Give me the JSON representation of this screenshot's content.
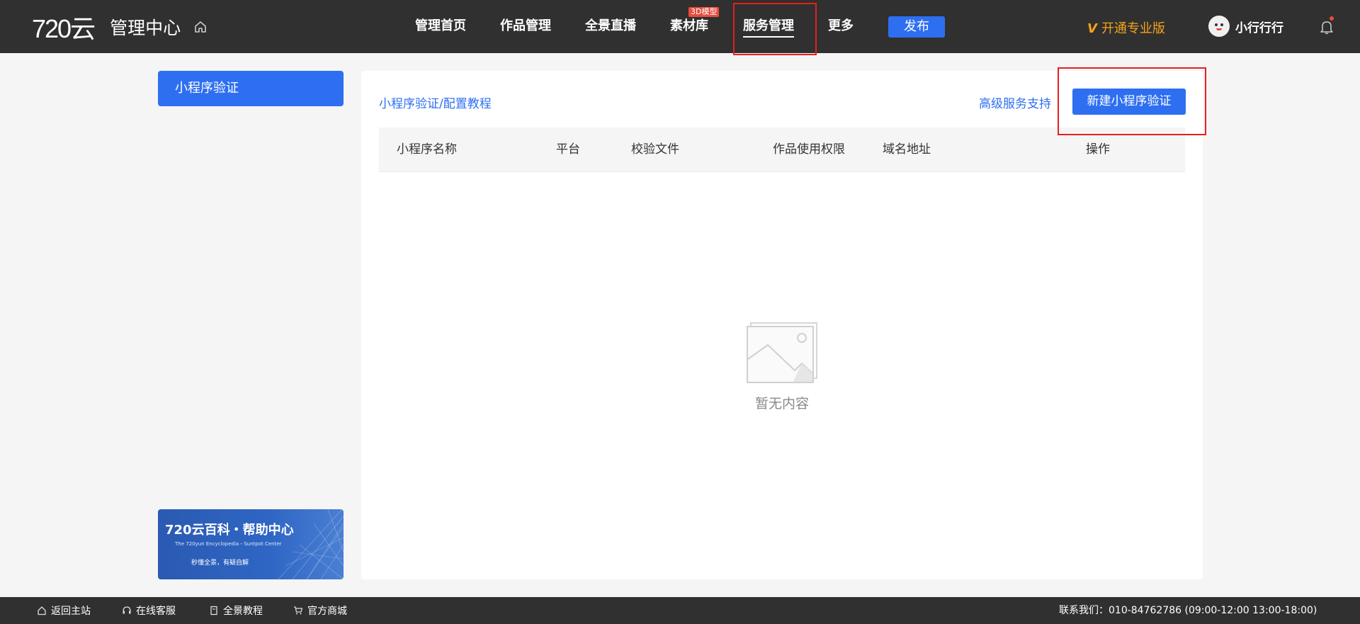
{
  "header": {
    "brand": "720云",
    "title": "管理中心",
    "nav": [
      {
        "label": "管理首页"
      },
      {
        "label": "作品管理"
      },
      {
        "label": "全景直播"
      },
      {
        "label": "素材库",
        "badge": "3D模型"
      },
      {
        "label": "服务管理",
        "active": true
      },
      {
        "label": "更多"
      }
    ],
    "publish_label": "发布",
    "pro_v": "V",
    "pro_label": "开通专业版",
    "username": "小行行行"
  },
  "sidebar": {
    "items": [
      {
        "label": "小程序验证"
      }
    ],
    "banner": {
      "title": "720云百科・帮助中心",
      "subtitle": "The 720yun Encyclopedia・Suntpot Center",
      "tagline": "秒懂全景，有疑自解"
    }
  },
  "main": {
    "breadcrumb": "小程序验证/配置教程",
    "support_label": "高级服务支持",
    "new_button": "新建小程序验证",
    "table": {
      "columns": [
        "小程序名称",
        "平台",
        "校验文件",
        "作品使用权限",
        "域名地址",
        "操作"
      ],
      "rows": []
    },
    "empty_text": "暂无内容"
  },
  "footer": {
    "links": [
      {
        "label": "返回主站",
        "icon": "home-icon"
      },
      {
        "label": "在线客服",
        "icon": "headset-icon"
      },
      {
        "label": "全景教程",
        "icon": "book-icon"
      },
      {
        "label": "官方商城",
        "icon": "cart-icon"
      }
    ],
    "contact": "联系我们：010-84762786 (09:00-12:00 13:00-18:00)"
  },
  "colors": {
    "topbar": "#303030",
    "accent": "#2e6ff2",
    "pro": "#f4a41a",
    "highlight": "#e61f1f"
  }
}
